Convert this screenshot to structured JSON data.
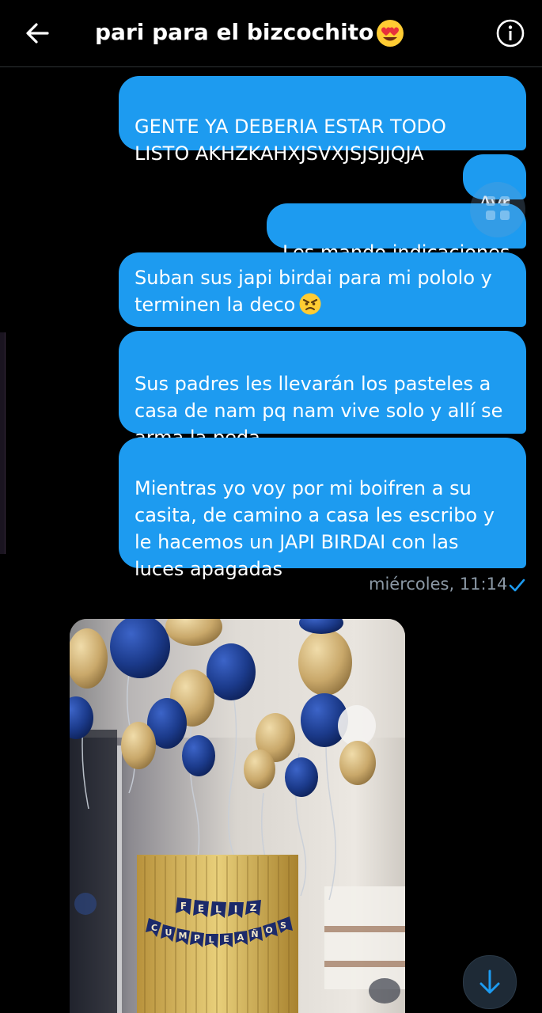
{
  "header": {
    "title": "pari para el bizcochito",
    "title_emoji": "heart-eyes-emoji",
    "back_icon": "arrow-left-icon",
    "info_icon": "info-icon"
  },
  "messages": [
    {
      "text": "GENTE YA DEBERIA ESTAR TODO\nLISTO AKHZKAHXJSVXJSJSJJQJA"
    },
    {
      "text": "Avr"
    },
    {
      "text": "Les mando indicaciones"
    },
    {
      "text": "Suban sus japi birdai para mi pololo y\nterminen la deco",
      "emoji": "angry-face-emoji"
    },
    {
      "text": "Sus padres les llevarán los pasteles a\ncasa de nam pq nam vive solo y allí se\narma la peda"
    },
    {
      "text": "Mientras yo voy por mi boifren a su\ncasita, de camino a casa les escribo y\nle hacemos un JAPI BIRDAI con las\nluces apagadas"
    }
  ],
  "timestamp": "miércoles, 11:14",
  "photo": {
    "banner_line1": [
      "F",
      "E",
      "L",
      "I",
      "Z"
    ],
    "banner_line2": [
      "C",
      "U",
      "M",
      "P",
      "L",
      "E",
      "A",
      "Ñ",
      "O",
      "S"
    ]
  },
  "colors": {
    "bubble": "#1d9bf0",
    "background": "#000000",
    "muted": "#8b98a5",
    "balloon_blue": "#1b3a8a",
    "balloon_gold": "#c9a86a"
  }
}
